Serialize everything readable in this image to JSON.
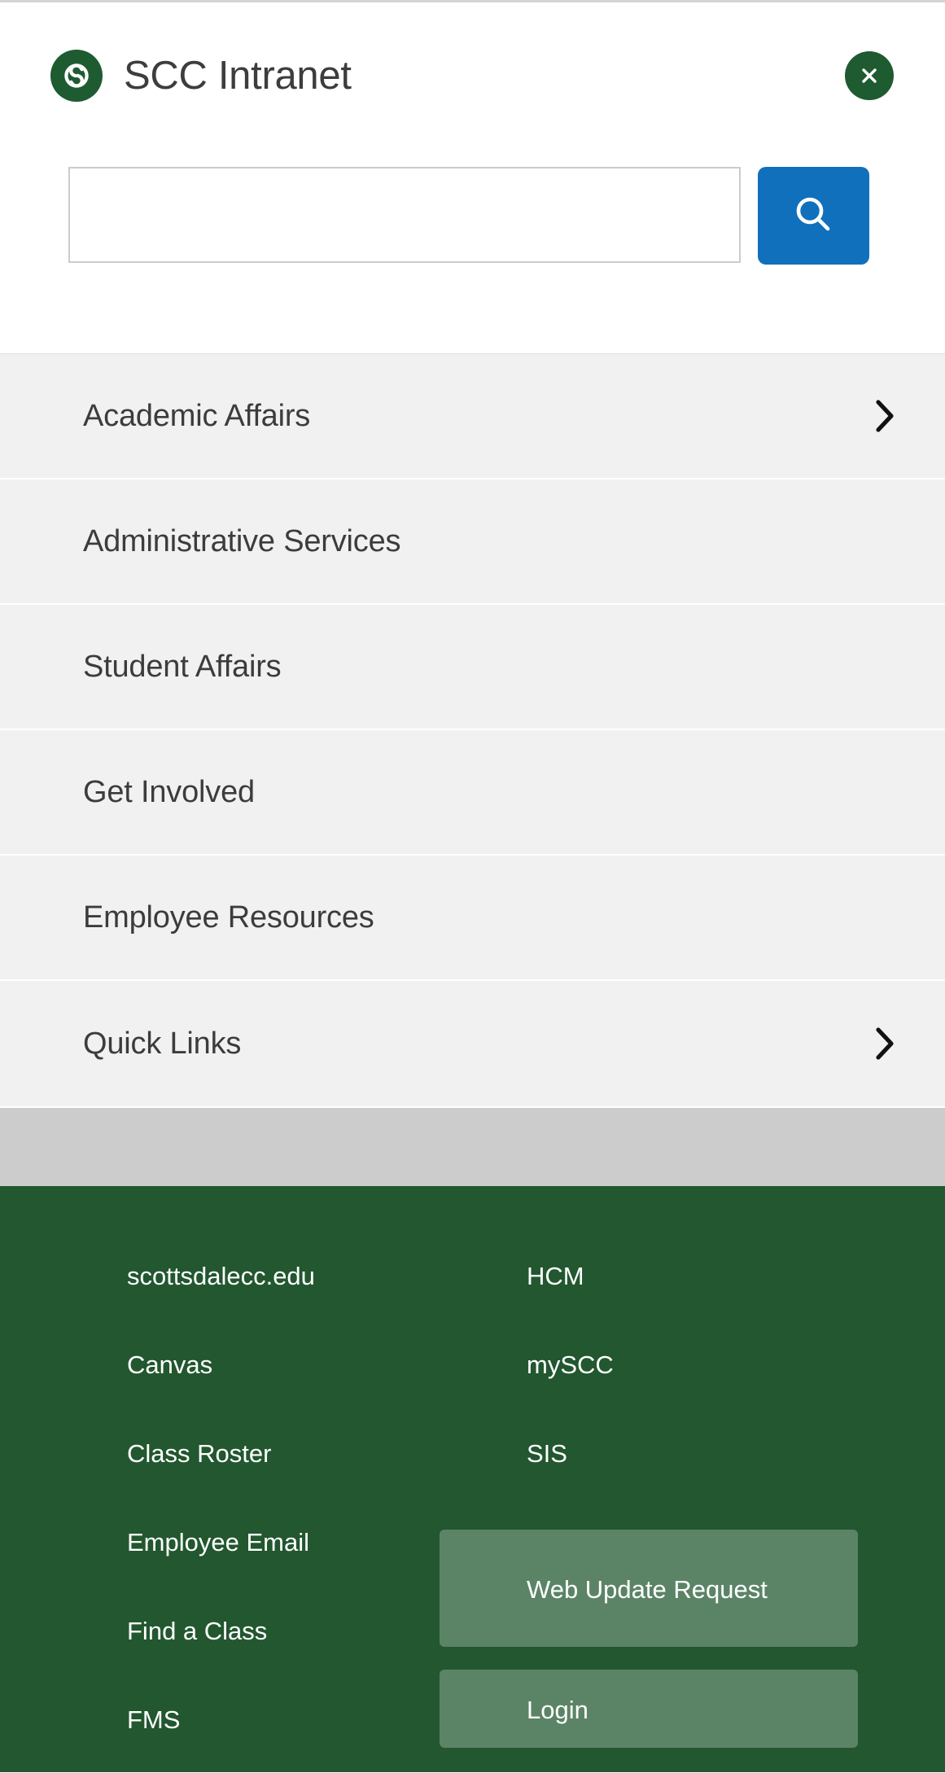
{
  "header": {
    "logo_icon": "scc-s-logo-icon",
    "title": "SCC Intranet",
    "close_icon": "close-x-icon",
    "close_label": "Close"
  },
  "search": {
    "value": "",
    "placeholder": "",
    "button_icon": "search-magnifier-icon",
    "button_label": "Search"
  },
  "nav": {
    "items": [
      {
        "label": "Academic Affairs",
        "chevron": true
      },
      {
        "label": "Administrative Services",
        "chevron": false
      },
      {
        "label": "Student Affairs",
        "chevron": false
      },
      {
        "label": "Get Involved",
        "chevron": false
      },
      {
        "label": "Employee Resources",
        "chevron": false
      },
      {
        "label": "Quick Links",
        "chevron": true
      }
    ]
  },
  "footer": {
    "left_links": [
      "scottsdalecc.edu",
      "Canvas",
      "Class Roster",
      "Employee Email",
      "Find a Class",
      "FMS"
    ],
    "right_links": [
      "HCM",
      "mySCC",
      "SIS"
    ],
    "buttons": [
      "Web Update Request",
      "Login"
    ]
  },
  "colors": {
    "brand_green": "#1e5b30",
    "footer_green": "#22572f",
    "footer_button_green": "#5b8467",
    "search_blue": "#1170bb",
    "nav_bg": "#f1f1f1",
    "gray_band": "#cccccc",
    "text_dark": "#3d3d3d"
  }
}
